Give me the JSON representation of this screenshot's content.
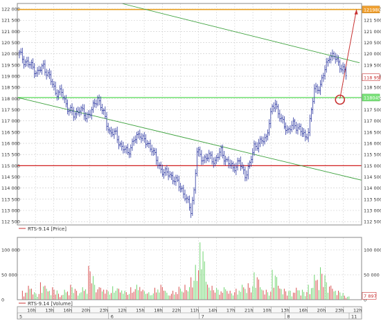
{
  "chart_data": [
    {
      "type": "ohlc",
      "title": "",
      "legend": "RTS-9.14 [Price]",
      "y_ticks": [
        122000,
        121500,
        121000,
        120500,
        120000,
        119500,
        119000,
        118500,
        118000,
        117500,
        117000,
        116500,
        116000,
        115500,
        115000,
        114500,
        114000,
        113500,
        113000,
        112500
      ],
      "y_tick_labels": [
        "122 000",
        "121 500",
        "121 000",
        "120 500",
        "120 000",
        "119 500",
        "119 000",
        "118 500",
        "118 000",
        "117 500",
        "117 000",
        "116 500",
        "116 000",
        "115 500",
        "115 000",
        "114 500",
        "114 000",
        "113 500",
        "113 000",
        "112 500"
      ],
      "ylim": [
        112350,
        122250
      ],
      "level_labels": {
        "high": "121980",
        "last": "118 950",
        "mid": "118045"
      },
      "annotations": [
        "horizontal line at 121980 (orange)",
        "horizontal line at 118045 (light green)",
        "horizontal line at 115000 (red)",
        "descending green trend channel",
        "red projection arrow to 121980",
        "red circle marker near 118000"
      ],
      "series": [
        {
          "values": [
            {
              "t": 0,
              "c": 120000
            },
            {
              "t": 3,
              "c": 119700
            },
            {
              "t": 8,
              "c": 119450
            },
            {
              "t": 12,
              "c": 119150
            },
            {
              "t": 16,
              "c": 119450
            },
            {
              "t": 20,
              "c": 118950
            },
            {
              "t": 24,
              "c": 118300
            },
            {
              "t": 28,
              "c": 118250
            },
            {
              "t": 32,
              "c": 117600
            },
            {
              "t": 36,
              "c": 117250
            },
            {
              "t": 40,
              "c": 117550
            },
            {
              "t": 44,
              "c": 117200
            },
            {
              "t": 48,
              "c": 117450
            },
            {
              "t": 52,
              "c": 118050
            },
            {
              "t": 56,
              "c": 117300
            },
            {
              "t": 60,
              "c": 116500
            },
            {
              "t": 64,
              "c": 116400
            },
            {
              "t": 68,
              "c": 115800
            },
            {
              "t": 72,
              "c": 115600
            },
            {
              "t": 76,
              "c": 116100
            },
            {
              "t": 80,
              "c": 116450
            },
            {
              "t": 84,
              "c": 116000
            },
            {
              "t": 88,
              "c": 115800
            },
            {
              "t": 92,
              "c": 115050
            },
            {
              "t": 96,
              "c": 114700
            },
            {
              "t": 100,
              "c": 114600
            },
            {
              "t": 104,
              "c": 114300
            },
            {
              "t": 108,
              "c": 113950
            },
            {
              "t": 112,
              "c": 113300
            },
            {
              "t": 114,
              "c": 113000
            },
            {
              "t": 116,
              "c": 113900
            },
            {
              "t": 118,
              "c": 115600
            },
            {
              "t": 122,
              "c": 115300
            },
            {
              "t": 126,
              "c": 115400
            },
            {
              "t": 130,
              "c": 115200
            },
            {
              "t": 134,
              "c": 115650
            },
            {
              "t": 138,
              "c": 115150
            },
            {
              "t": 142,
              "c": 114900
            },
            {
              "t": 146,
              "c": 115150
            },
            {
              "t": 150,
              "c": 114600
            },
            {
              "t": 153,
              "c": 115000
            },
            {
              "t": 156,
              "c": 115900
            },
            {
              "t": 160,
              "c": 116000
            },
            {
              "t": 164,
              "c": 116300
            },
            {
              "t": 168,
              "c": 117550
            },
            {
              "t": 170,
              "c": 117800
            },
            {
              "t": 174,
              "c": 117000
            },
            {
              "t": 178,
              "c": 116600
            },
            {
              "t": 182,
              "c": 116800
            },
            {
              "t": 186,
              "c": 116700
            },
            {
              "t": 190,
              "c": 116200
            },
            {
              "t": 192,
              "c": 116600
            },
            {
              "t": 196,
              "c": 118350
            },
            {
              "t": 200,
              "c": 118600
            },
            {
              "t": 204,
              "c": 119500
            },
            {
              "t": 206,
              "c": 119950
            },
            {
              "t": 210,
              "c": 119800
            },
            {
              "t": 214,
              "c": 119400
            },
            {
              "t": 218,
              "c": 118950
            }
          ]
        }
      ]
    },
    {
      "type": "bar",
      "legend": "RTS-9.14 [Volume]",
      "y_ticks": [
        100000,
        50000,
        0
      ],
      "y_tick_labels": [
        "100 000",
        "50 000",
        "0"
      ],
      "ylim": [
        0,
        125000
      ],
      "last_value_label": "7 897",
      "up_color": "#6fd46f",
      "down_color": "#d85050",
      "values": [
        {
          "t": 2,
          "v": 18000,
          "d": "down"
        },
        {
          "t": 6,
          "v": 28000,
          "d": "down"
        },
        {
          "t": 10,
          "v": 15000,
          "d": "up"
        },
        {
          "t": 14,
          "v": 35000,
          "d": "down"
        },
        {
          "t": 18,
          "v": 22000,
          "d": "up"
        },
        {
          "t": 22,
          "v": 25000,
          "d": "down"
        },
        {
          "t": 26,
          "v": 12000,
          "d": "down"
        },
        {
          "t": 30,
          "v": 20000,
          "d": "up"
        },
        {
          "t": 34,
          "v": 30000,
          "d": "down"
        },
        {
          "t": 38,
          "v": 18000,
          "d": "down"
        },
        {
          "t": 42,
          "v": 25000,
          "d": "up"
        },
        {
          "t": 46,
          "v": 68000,
          "d": "down"
        },
        {
          "t": 50,
          "v": 30000,
          "d": "up"
        },
        {
          "t": 54,
          "v": 24000,
          "d": "down"
        },
        {
          "t": 58,
          "v": 20000,
          "d": "down"
        },
        {
          "t": 62,
          "v": 27000,
          "d": "up"
        },
        {
          "t": 66,
          "v": 22000,
          "d": "down"
        },
        {
          "t": 70,
          "v": 18000,
          "d": "up"
        },
        {
          "t": 74,
          "v": 25000,
          "d": "down"
        },
        {
          "t": 78,
          "v": 30000,
          "d": "up"
        },
        {
          "t": 82,
          "v": 20000,
          "d": "down"
        },
        {
          "t": 86,
          "v": 15000,
          "d": "up"
        },
        {
          "t": 90,
          "v": 24000,
          "d": "down"
        },
        {
          "t": 94,
          "v": 30000,
          "d": "down"
        },
        {
          "t": 98,
          "v": 14000,
          "d": "up"
        },
        {
          "t": 102,
          "v": 18000,
          "d": "down"
        },
        {
          "t": 106,
          "v": 26000,
          "d": "down"
        },
        {
          "t": 110,
          "v": 30000,
          "d": "down"
        },
        {
          "t": 114,
          "v": 45000,
          "d": "down"
        },
        {
          "t": 117,
          "v": 70000,
          "d": "up"
        },
        {
          "t": 120,
          "v": 115000,
          "d": "up"
        },
        {
          "t": 124,
          "v": 36000,
          "d": "up"
        },
        {
          "t": 128,
          "v": 28000,
          "d": "down"
        },
        {
          "t": 132,
          "v": 20000,
          "d": "up"
        },
        {
          "t": 136,
          "v": 25000,
          "d": "up"
        },
        {
          "t": 140,
          "v": 18000,
          "d": "down"
        },
        {
          "t": 144,
          "v": 22000,
          "d": "down"
        },
        {
          "t": 148,
          "v": 30000,
          "d": "up"
        },
        {
          "t": 152,
          "v": 33000,
          "d": "down"
        },
        {
          "t": 156,
          "v": 55000,
          "d": "up"
        },
        {
          "t": 160,
          "v": 25000,
          "d": "up"
        },
        {
          "t": 164,
          "v": 20000,
          "d": "down"
        },
        {
          "t": 168,
          "v": 60000,
          "d": "up"
        },
        {
          "t": 172,
          "v": 28000,
          "d": "down"
        },
        {
          "t": 176,
          "v": 22000,
          "d": "down"
        },
        {
          "t": 180,
          "v": 18000,
          "d": "up"
        },
        {
          "t": 184,
          "v": 24000,
          "d": "down"
        },
        {
          "t": 188,
          "v": 20000,
          "d": "up"
        },
        {
          "t": 192,
          "v": 30000,
          "d": "up"
        },
        {
          "t": 196,
          "v": 50000,
          "d": "up"
        },
        {
          "t": 200,
          "v": 65000,
          "d": "up"
        },
        {
          "t": 204,
          "v": 35000,
          "d": "up"
        },
        {
          "t": 208,
          "v": 22000,
          "d": "down"
        },
        {
          "t": 212,
          "v": 18000,
          "d": "down"
        },
        {
          "t": 216,
          "v": 8000,
          "d": "down"
        }
      ]
    }
  ],
  "time_axis": {
    "hour_labels": [
      "10h",
      "13h",
      "16h",
      "20h",
      "23h",
      "12h",
      "15h",
      "18h",
      "22h",
      "11h",
      "14h",
      "17h",
      "21h",
      "10h",
      "13h",
      "16h",
      "20h",
      "23h",
      "12h"
    ],
    "day_labels": [
      "5",
      "6",
      "7",
      "8",
      "11"
    ]
  },
  "colors": {
    "price_bar": "#2a35a0",
    "grid": "#c8c8c8",
    "trend_line": "#3aa03a",
    "level_high": "#e8a020",
    "level_mid": "#7ce27c",
    "level_support": "#d02020",
    "arrow": "#c83030"
  }
}
